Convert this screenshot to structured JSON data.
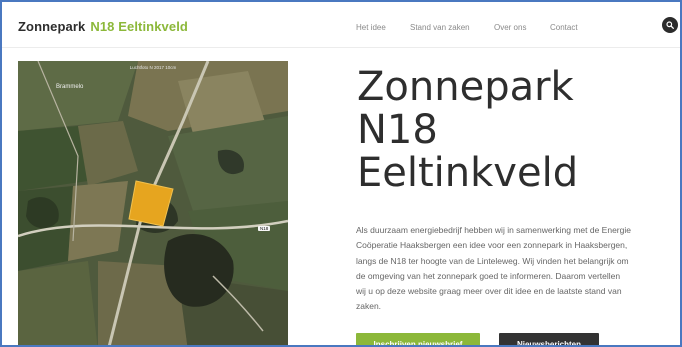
{
  "header": {
    "logo_part1": "Zonnepark",
    "logo_part2": "N18 Eeltinkveld",
    "nav": [
      {
        "label": "Het idee"
      },
      {
        "label": "Stand van zaken"
      },
      {
        "label": "Over ons"
      },
      {
        "label": "Contact"
      }
    ],
    "search_icon": "search-icon"
  },
  "map": {
    "caption": "Luchtfoto N 2017 10cm",
    "place_label": "Brammelo",
    "road_label": "N18",
    "highlight_color": "#e6a51f"
  },
  "hero": {
    "title_lines": [
      "Zonnepark",
      "N18",
      "Eeltinkveld"
    ],
    "intro": "Als duurzaam energiebedrijf hebben wij in samenwerking met de Energie Coöperatie Haaksbergen een idee voor een zonnepark in Haaksbergen, langs de N18 ter hoogte van de Linteleweg. Wij vinden het belangrijk om de omgeving van het zonnepark goed te informeren. Daarom vertellen wij u op deze website graag meer over dit idee en de laatste stand van zaken."
  },
  "buttons": {
    "subscribe": "Inschrijven nieuwsbrief",
    "news": "Nieuwsberichten"
  },
  "colors": {
    "accent": "#8cb83a",
    "dark": "#333333",
    "frame": "#4a78c0"
  }
}
